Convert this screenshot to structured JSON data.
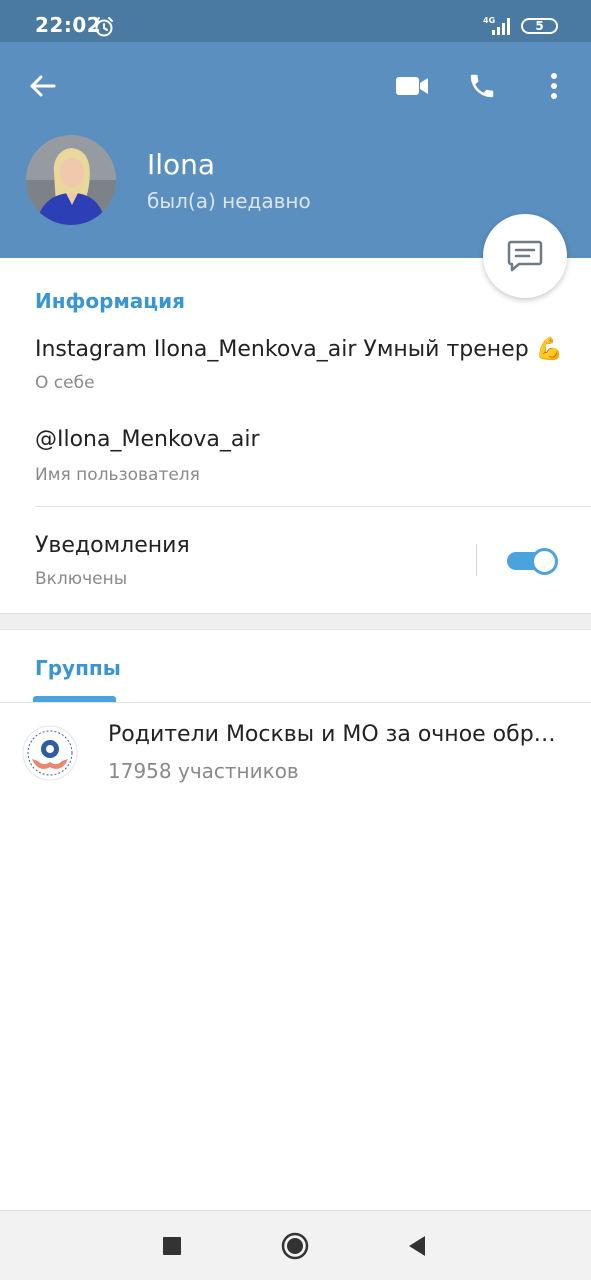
{
  "status_bar": {
    "time": "22:02",
    "network": "4G",
    "battery": "5"
  },
  "header": {
    "name": "Ilona",
    "status": "был(а) недавно"
  },
  "info": {
    "section_title": "Информация",
    "bio_value": "Instagram Ilona_Menkova_air Умный тренер 💪",
    "bio_label": "О себе",
    "username_value": "@Ilona_Menkova_air",
    "username_label": "Имя пользователя",
    "notifications_title": "Уведомления",
    "notifications_status": "Включены",
    "notifications_enabled": true
  },
  "groups": {
    "tab_label": "Группы",
    "items": [
      {
        "name": "Родители Москвы и МО за очное образование",
        "members": "17958 участников"
      }
    ]
  },
  "colors": {
    "header": "#5b8fbf",
    "status_bar": "#4a7aa1",
    "accent": "#3a95d3",
    "toggle": "#4aa3df"
  },
  "icons": [
    "alarm-icon",
    "signal-icon",
    "battery-icon",
    "back-arrow-icon",
    "video-camera-icon",
    "phone-icon",
    "more-vertical-icon",
    "message-icon",
    "recents-icon",
    "home-icon",
    "nav-back-icon"
  ]
}
